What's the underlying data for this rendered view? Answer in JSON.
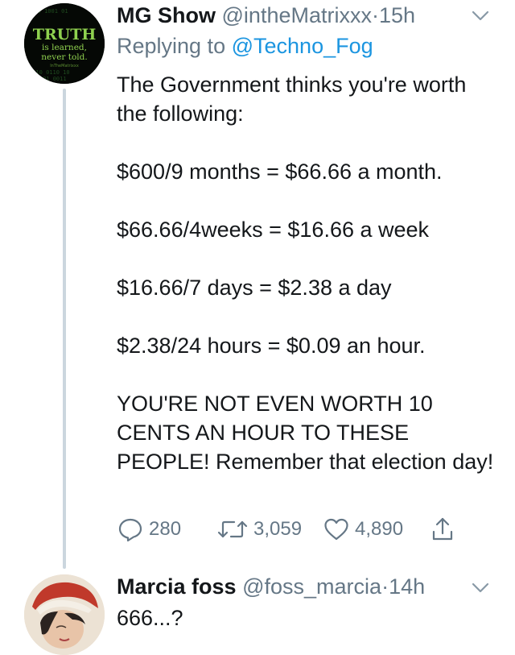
{
  "tweet1": {
    "display_name": "MG Show",
    "handle": "@intheMatrixxx",
    "separator": "·",
    "time": "15h",
    "replying_label": "Replying to",
    "replying_to": "@Techno_Fog",
    "avatar": {
      "title": "TRUTH",
      "line1": "is learned,",
      "line2": "never told.",
      "small": "InTheMatrixxx"
    },
    "paragraphs": [
      "The Government thinks you're worth the following:",
      "$600/9 months = $66.66 a month.",
      "$66.66/4weeks = $16.66 a week",
      "$16.66/7 days = $2.38 a day",
      "$2.38/24 hours = $0.09 an hour.",
      "YOU'RE NOT EVEN WORTH 10 CENTS AN HOUR TO THESE PEOPLE! Remember that election day!"
    ],
    "actions": {
      "replies": "280",
      "retweets": "3,059",
      "likes": "4,890"
    }
  },
  "tweet2": {
    "display_name": "Marcia foss",
    "handle": "@foss_marcia",
    "separator": "·",
    "time": "14h",
    "text": "666...?"
  },
  "colors": {
    "secondary_text": "#657786",
    "link": "#1b95e0",
    "thread_line": "#cbd6de",
    "avatar_green": "#8fd14f"
  }
}
